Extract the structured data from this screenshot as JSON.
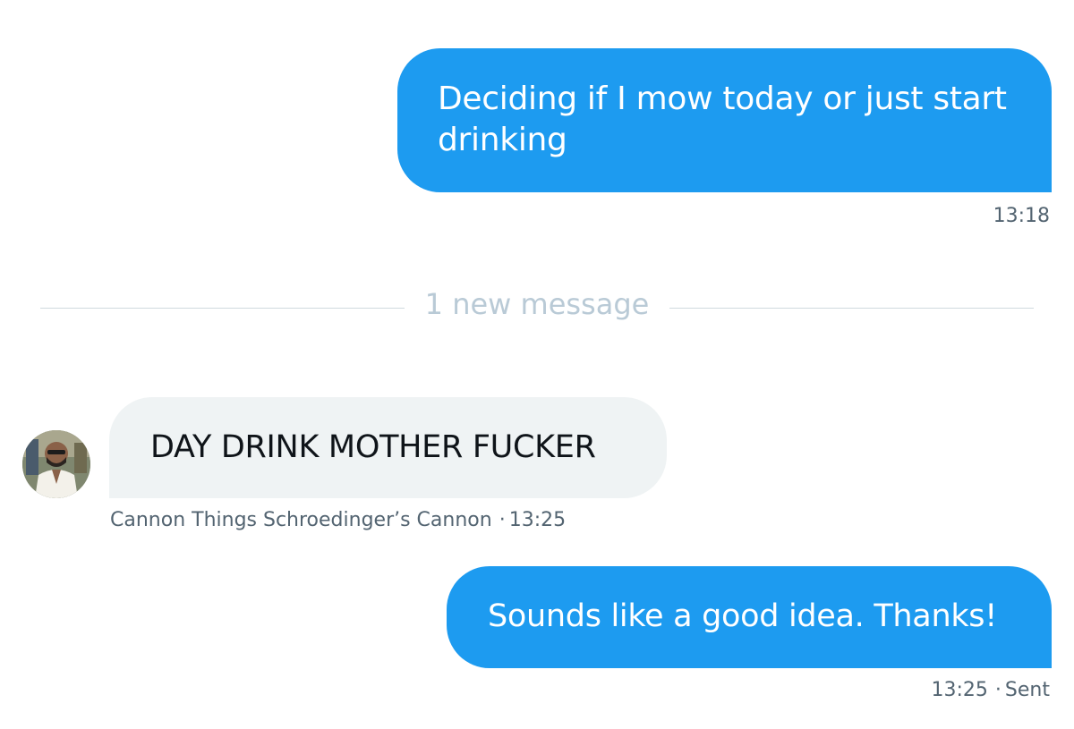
{
  "conversation": {
    "messages": [
      {
        "direction": "outgoing",
        "text": "Deciding if I mow today or just start drinking",
        "time": "13:18"
      },
      {
        "direction": "incoming",
        "text": "DAY DRINK MOTHER FUCKER",
        "sender": "Cannon Things Schroedinger’s Cannon",
        "time": "13:25"
      },
      {
        "direction": "outgoing",
        "text": "Sounds like a good idea. Thanks!",
        "time": "13:25",
        "status": "Sent"
      }
    ],
    "divider_label": "1 new message",
    "separator": "·"
  },
  "colors": {
    "outgoing_bubble": "#1d9bf0",
    "incoming_bubble": "#eff3f4",
    "meta_text": "#536471",
    "divider_text": "#b9cad6"
  },
  "icons": {
    "avatar": "user-avatar-photo"
  }
}
